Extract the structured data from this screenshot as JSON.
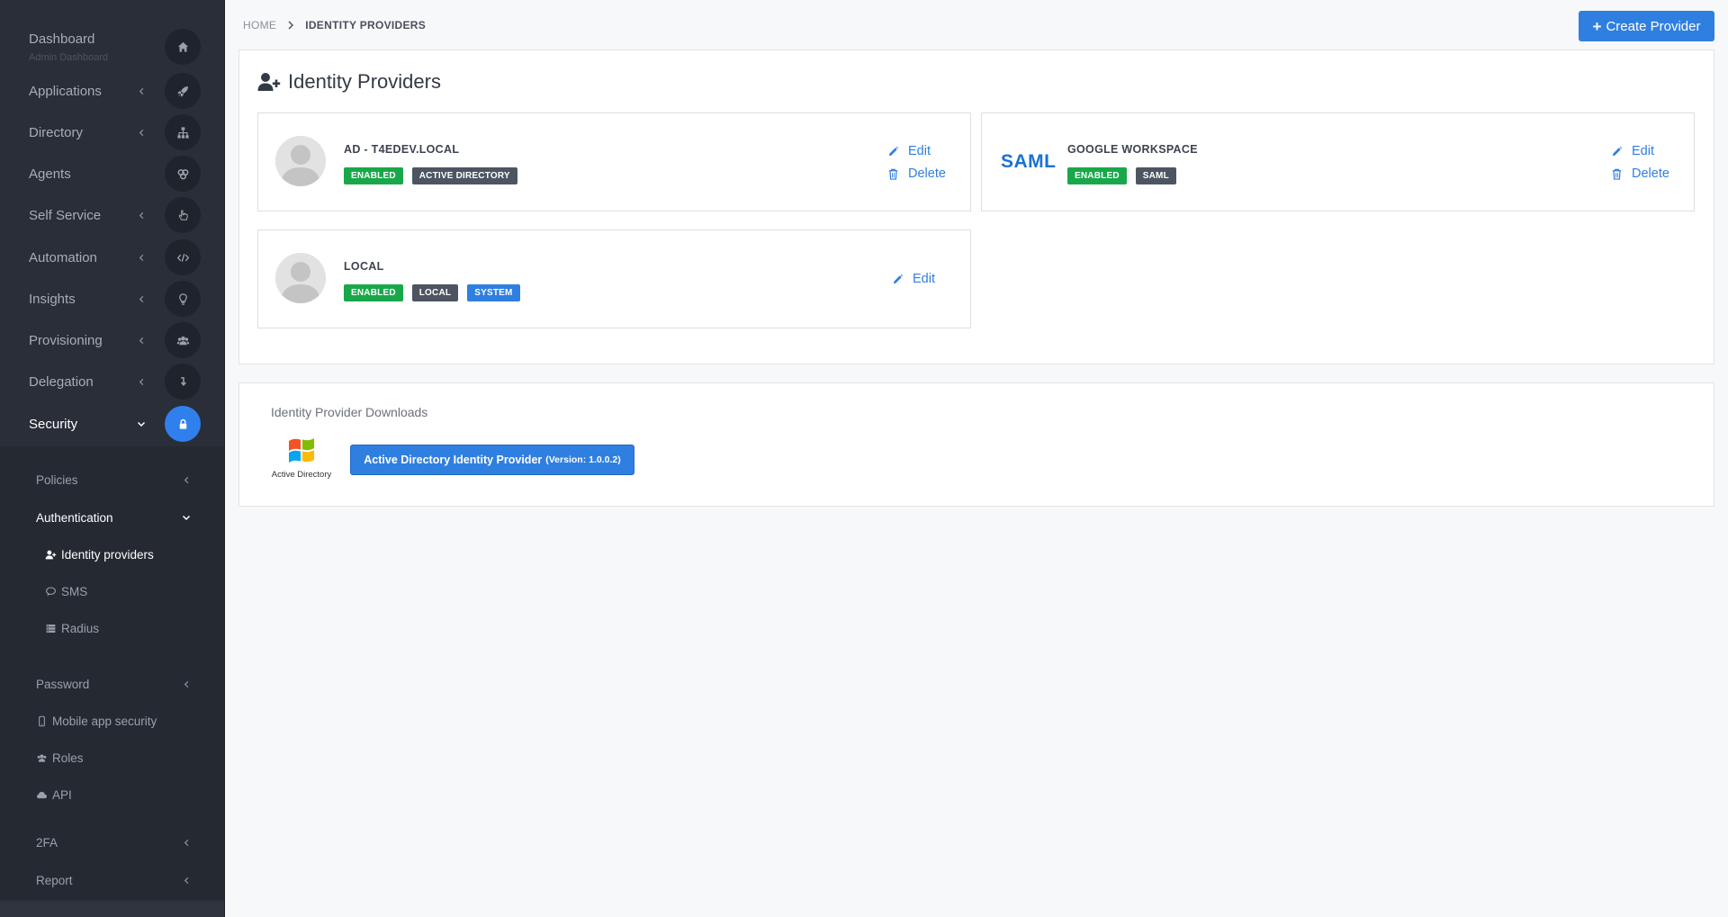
{
  "sidebar": {
    "dashboard": {
      "label": "Dashboard",
      "sub": "Admin Dashboard"
    },
    "items": [
      {
        "label": "Applications",
        "icon": "rocket-icon"
      },
      {
        "label": "Directory",
        "icon": "sitemap-icon"
      },
      {
        "label": "Agents",
        "icon": "agents-icon"
      },
      {
        "label": "Self Service",
        "icon": "hand-pointer-icon"
      },
      {
        "label": "Automation",
        "icon": "code-icon"
      },
      {
        "label": "Insights",
        "icon": "lightbulb-icon"
      },
      {
        "label": "Provisioning",
        "icon": "users-icon"
      },
      {
        "label": "Delegation",
        "icon": "arrow-down-icon"
      },
      {
        "label": "Security",
        "icon": "lock-icon"
      }
    ],
    "submenu": {
      "policies": "Policies",
      "authentication": "Authentication",
      "identity_providers": "Identity providers",
      "sms": "SMS",
      "radius": "Radius",
      "password": "Password",
      "mobile_app_security": "Mobile app security",
      "roles": "Roles",
      "api": "API",
      "twofa": "2FA",
      "report": "Report"
    }
  },
  "breadcrumb": {
    "home": "HOME",
    "current": "IDENTITY PROVIDERS"
  },
  "toolbar": {
    "create_label": "Create Provider"
  },
  "providers_panel": {
    "title": "Identity Providers"
  },
  "providers": [
    {
      "name": "AD - T4EDEV.LOCAL",
      "badges": [
        "ENABLED",
        "ACTIVE DIRECTORY"
      ],
      "edit": "Edit",
      "delete": "Delete"
    },
    {
      "name": "GOOGLE WORKSPACE",
      "logo_text": "SAML",
      "badges": [
        "ENABLED",
        "SAML"
      ],
      "edit": "Edit",
      "delete": "Delete"
    },
    {
      "name": "LOCAL",
      "badges": [
        "ENABLED",
        "LOCAL",
        "SYSTEM"
      ],
      "edit": "Edit"
    }
  ],
  "downloads": {
    "title": "Identity Provider Downloads",
    "logo_caption": "Active Directory",
    "button_label": "Active Directory Identity Provider",
    "button_version": "(Version: 1.0.0.2)"
  },
  "colors": {
    "accent": "#2f7fe0",
    "sidebar": "#2a2e38",
    "enabled": "#18a84a",
    "tag": "#4d5562"
  }
}
